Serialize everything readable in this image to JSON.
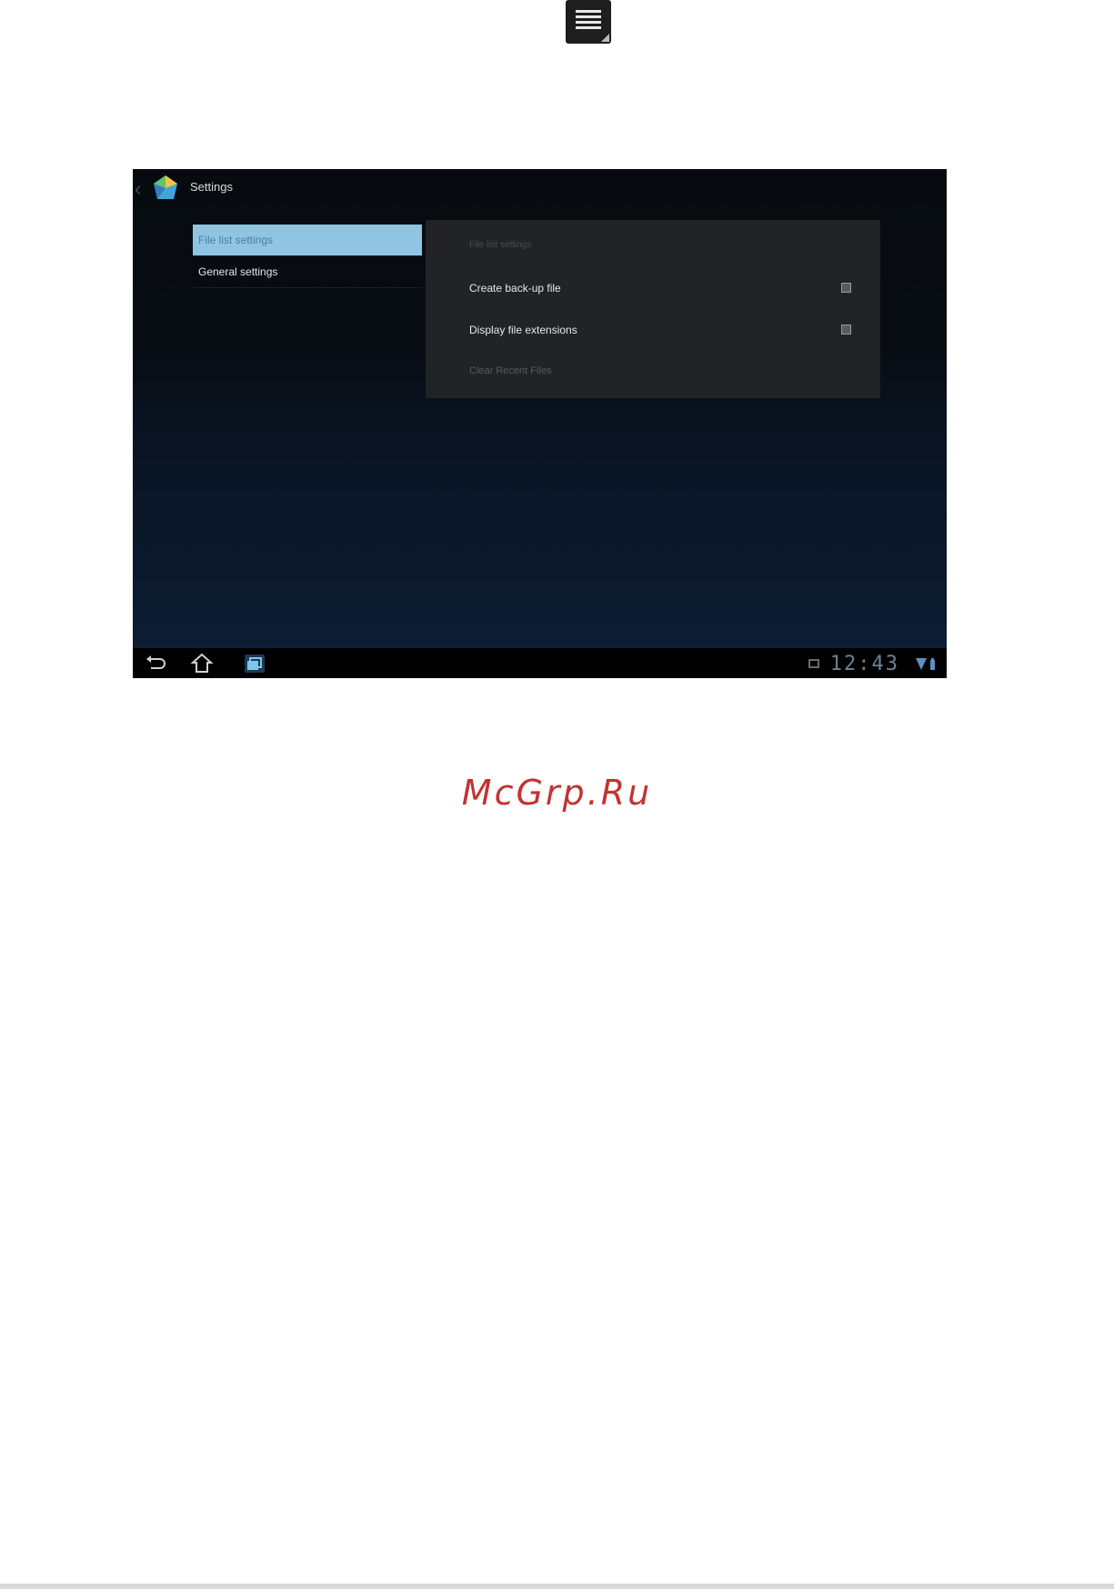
{
  "top_menu": {
    "icon": "menu-icon"
  },
  "device": {
    "action_bar": {
      "title": "Settings",
      "app_icon": "settings-app-icon"
    },
    "left_list": [
      {
        "label": "File list settings",
        "selected": true
      },
      {
        "label": "General settings",
        "selected": false
      }
    ],
    "panel": {
      "header": "File list settings",
      "options": [
        {
          "label": "Create back-up file",
          "checked": false
        },
        {
          "label": "Display file extensions",
          "checked": false
        }
      ],
      "clear_recent": "Clear Recent Files"
    },
    "nav_bar": {
      "back_icon": "back-icon",
      "home_icon": "home-icon",
      "recent_icon": "recent-apps-icon",
      "clock": "12:43",
      "signal_icon": "wifi-battery-icon"
    }
  },
  "watermark": "McGrp.Ru",
  "colors": {
    "selected_item_bg": "#8fc4e3",
    "panel_bg": "#222325",
    "watermark": "#c43232",
    "clock": "#6d8294"
  }
}
